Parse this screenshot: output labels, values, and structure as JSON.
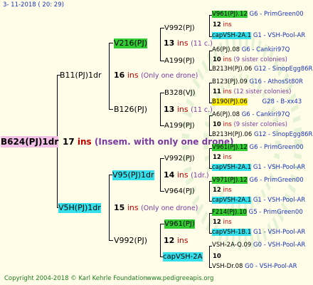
{
  "date": "3-  11-2018  ( 20:  29)",
  "footer": {
    "copyright": "Copyright 2004-2018 © Karl Kehrle Foundation",
    "site": "www.pedigreeapis.org"
  },
  "root": {
    "name": "B624(PJ)1dr",
    "count": "17",
    "ins": "ins",
    "note": "(Insem. with only one drone)"
  },
  "gen1": [
    {
      "name": "B11(PJ)1dr",
      "count": "16",
      "ins": "ins",
      "note": "(Only one drone)"
    },
    {
      "name": "V5H(PJ)1dr",
      "count": "15",
      "ins": "ins",
      "note": "(Only one drone)"
    }
  ],
  "gen2": [
    {
      "name": "V216(PJ)",
      "count": "",
      "ins": "",
      "note": ""
    },
    {
      "name": "B126(PJ)",
      "count": "13",
      "ins": "ins",
      "note": "(11 c.)"
    },
    {
      "name": "V95(PJ)1dr",
      "count": "14",
      "ins": "ins",
      "note": "(1dr.)"
    },
    {
      "name": "V992(PJ)",
      "count": "12",
      "ins": "ins",
      "note": ""
    }
  ],
  "gen3": [
    {
      "name": "V992(PJ)",
      "count": "13",
      "ins": "ins",
      "note": "(11 c.)"
    },
    {
      "name": "A199(PJ)",
      "count": "",
      "ins": "",
      "note": ""
    },
    {
      "name": "B328(VJ)",
      "count": "",
      "ins": "",
      "note": ""
    },
    {
      "name": "A199(PJ)",
      "count": "",
      "ins": "",
      "note": ""
    },
    {
      "name": "V992(PJ)",
      "count": "",
      "ins": "",
      "note": ""
    },
    {
      "name": "V964(PJ)",
      "count": "",
      "ins": "",
      "note": ""
    },
    {
      "name": "V961(PJ)",
      "count": "",
      "ins": "",
      "note": ""
    },
    {
      "name": "capVSH-2A",
      "count": "10",
      "ins": "",
      "note": ""
    }
  ],
  "gen4": [
    {
      "a": "V961(PJ).12",
      "an": "G6 - PrimGreen00",
      "mid": "12",
      "ins": "ins",
      "note": "",
      "b": "capVSH-2A.1",
      "bn": "G1 - VSH-Pool-AR"
    },
    {
      "a": "A6(PJ).08",
      "an": "G6 - Cankiri97Q",
      "mid": "10",
      "ins": "ins",
      "note": "(9 sister colonies)",
      "b": "B213H(PJ).06",
      "bn": "G12 - SinopEgg86R"
    },
    {
      "a": "B123(PJ).09",
      "an": "G16 - AthosSt80R",
      "mid": "11",
      "ins": "ins",
      "note": "(12 sister colonies)",
      "b": "B190(PJ).06",
      "bn": "G28 - B-xx43"
    },
    {
      "a": "A6(PJ).08",
      "an": "G6 - Cankiri97Q",
      "mid": "10",
      "ins": "ins",
      "note": "(9 sister colonies)",
      "b": "B213H(PJ).06",
      "bn": "G12 - SinopEgg86R"
    },
    {
      "a": "V961(PJ).12",
      "an": "G6 - PrimGreen00",
      "mid": "12",
      "ins": "ins",
      "note": "",
      "b": "capVSH-2A.1",
      "bn": "G1 - VSH-Pool-AR"
    },
    {
      "a": "V971(PJ).12",
      "an": "G6 - PrimGreen00",
      "mid": "12",
      "ins": "ins",
      "note": "",
      "b": "capVSH-2A.1",
      "bn": "G1 - VSH-Pool-AR"
    },
    {
      "a": "F214(PJ).10",
      "an": "G5 - PrimGreen00",
      "mid": "12",
      "ins": "ins",
      "note": "",
      "b": "capVSH-1B.1",
      "bn": "G1 - VSH-Pool-AR"
    },
    {
      "a": "VSH-2A-Q.09",
      "an": "G0 - VSH-Pool-AR",
      "mid": "",
      "ins": "",
      "note": "",
      "b": "VSH-Dr.08",
      "bn": "G0 - VSH-Pool-AR"
    }
  ]
}
